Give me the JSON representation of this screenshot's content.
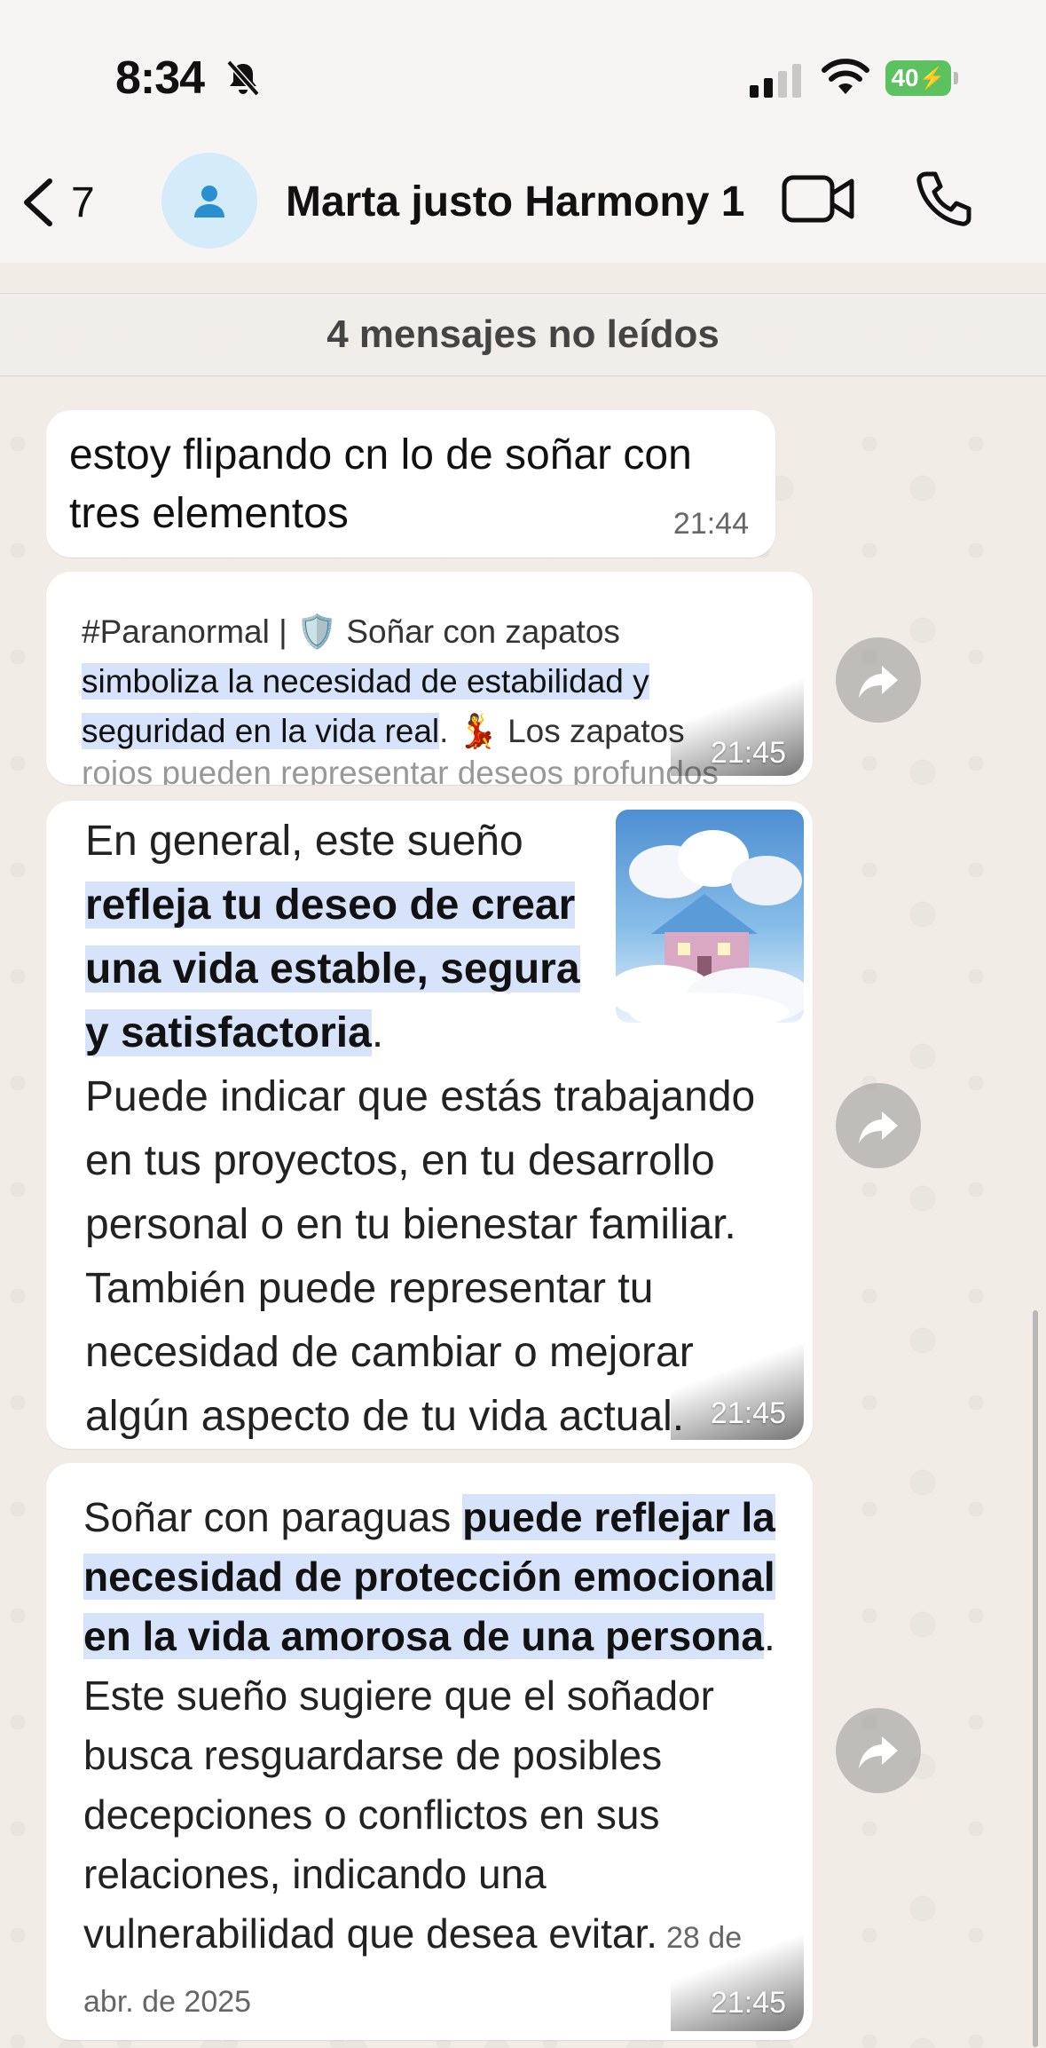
{
  "status_bar": {
    "time": "8:34",
    "battery": "40"
  },
  "header": {
    "back_count": "7",
    "contact_name": "Marta justo Harmony 1"
  },
  "unread_banner": "4 mensajes no leídos",
  "messages": [
    {
      "lines": [
        "estoy flipando cn lo de soñar con",
        "tres elementos"
      ],
      "time": "21:44"
    },
    {
      "prefix": "#Paranormal | ",
      "title_rest": " Soñar con zapatos",
      "highlight1": "simboliza la necesidad de estabilidad y",
      "highlight2": "seguridad en la vida real",
      "after": ". ",
      "after2": " Los zapatos",
      "cut_line": "rojos pueden representar deseos profundos",
      "time": "21:45"
    },
    {
      "lead": "En general, este sueño",
      "highlight": "refleja tu deseo de crear una vida estable, segura y satisfactoria",
      "end": ".",
      "lines": [
        "Puede indicar que estás trabajando",
        "en tus proyectos, en tu desarrollo",
        "personal o en tu bienestar familiar.",
        "También puede representar tu",
        "necesidad de cambiar o mejorar",
        "algún aspecto de tu vida actual."
      ],
      "time": "21:45"
    },
    {
      "lead": "Soñar con paraguas ",
      "highlight": "puede reflejar la necesidad de protección emocional en la vida amorosa de una persona",
      "rest": ". Este sueño sugiere que el soñador busca resguardarse de posibles decepciones o conflictos en sus relaciones, indicando una vulnerabilidad que desea evitar.",
      "date": "28 de abr. de 2025",
      "time": "21:45"
    }
  ]
}
